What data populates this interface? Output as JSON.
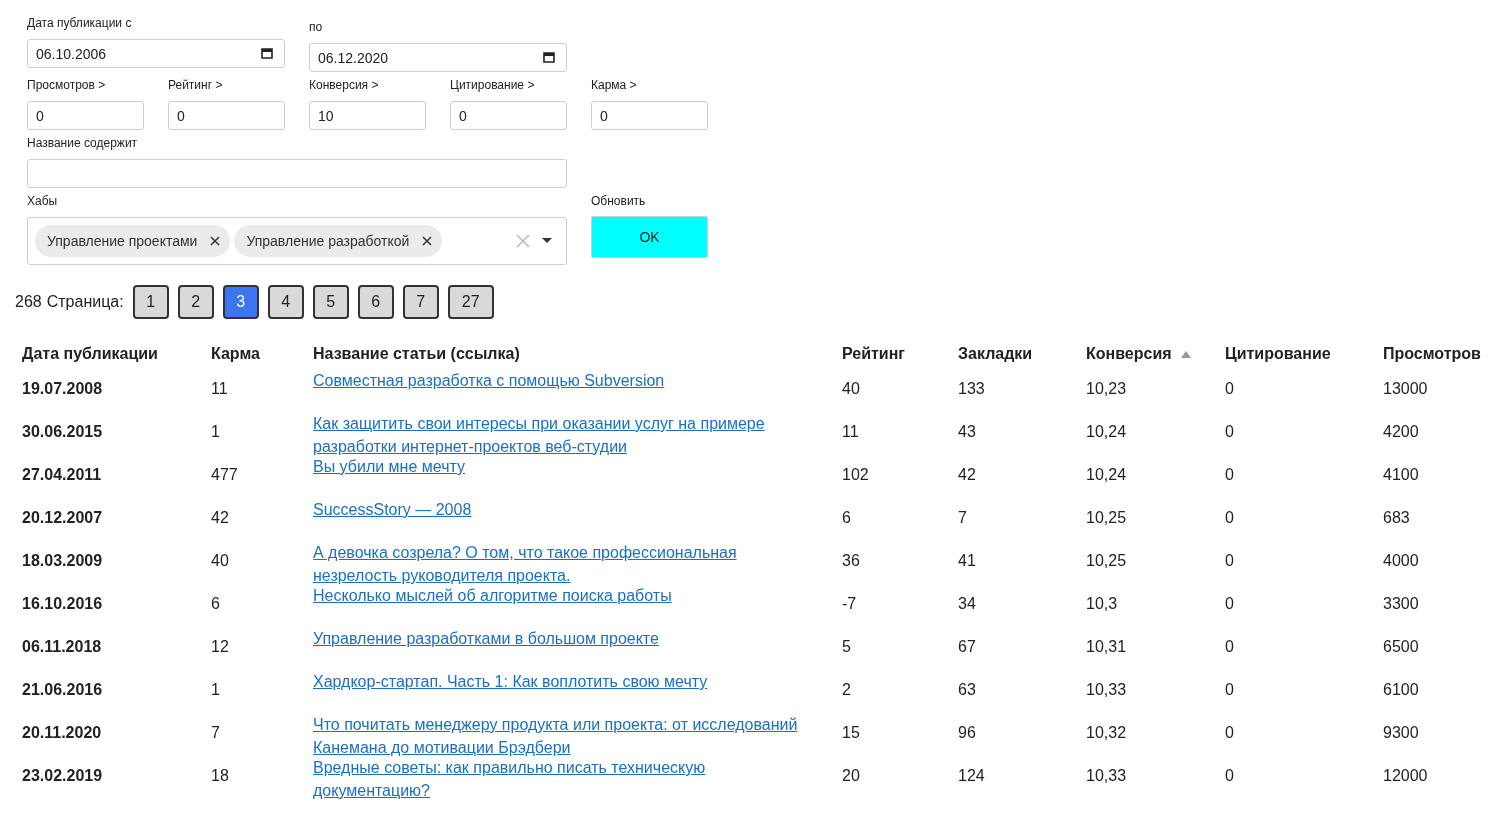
{
  "filters": {
    "date_from": {
      "label": "Дата публикации с",
      "value": "06.10.2006"
    },
    "date_to": {
      "label": "по",
      "value": "06.12.2020"
    },
    "thresholds": [
      {
        "label": "Просмотров >",
        "value": "0"
      },
      {
        "label": "Рейтинг >",
        "value": "0"
      },
      {
        "label": "Конверсия >",
        "value": "10"
      },
      {
        "label": "Цитирование >",
        "value": "0"
      },
      {
        "label": "Карма >",
        "value": "0"
      }
    ],
    "title_contains": {
      "label": "Название содержит"
    },
    "hubs": {
      "label": "Хабы",
      "chips": [
        "Управление проектами",
        "Управление разработкой"
      ]
    },
    "refresh": {
      "label": "Обновить",
      "button": "OK"
    }
  },
  "pagination": {
    "total": "268",
    "label": "Страница:",
    "pages": [
      {
        "label": "1",
        "selected": false
      },
      {
        "label": "2",
        "selected": false
      },
      {
        "label": "3",
        "selected": true
      },
      {
        "label": "4",
        "selected": false
      },
      {
        "label": "5",
        "selected": false
      },
      {
        "label": "6",
        "selected": false
      },
      {
        "label": "7",
        "selected": false
      },
      {
        "label": "27",
        "selected": false
      }
    ]
  },
  "table": {
    "columns": [
      {
        "label": "Дата публикации",
        "sorted": false
      },
      {
        "label": "Карма",
        "sorted": false
      },
      {
        "label": "Название статьи (ссылка)",
        "sorted": false
      },
      {
        "label": "Рейтинг",
        "sorted": false
      },
      {
        "label": "Закладки",
        "sorted": false
      },
      {
        "label": "Конверсия",
        "sorted": true
      },
      {
        "label": "Цитирование",
        "sorted": false
      },
      {
        "label": "Просмотров",
        "sorted": false
      }
    ],
    "rows": [
      [
        "19.07.2008",
        "11",
        "Совместная разработка с помощью Subversion",
        "40",
        "133",
        "10,23",
        "0",
        "13000"
      ],
      [
        "30.06.2015",
        "1",
        "Как защитить свои интересы при оказании услуг на примере разработки интернет-проектов веб-студии",
        "11",
        "43",
        "10,24",
        "0",
        "4200"
      ],
      [
        "27.04.2011",
        "477",
        "Вы убили мне мечту",
        "102",
        "42",
        "10,24",
        "0",
        "4100"
      ],
      [
        "20.12.2007",
        "42",
        "SuccessStory — 2008",
        "6",
        "7",
        "10,25",
        "0",
        "683"
      ],
      [
        "18.03.2009",
        "40",
        "А девочка созрела? О том, что такое профессиональная незрелость руководителя проекта.",
        "36",
        "41",
        "10,25",
        "0",
        "4000"
      ],
      [
        "16.10.2016",
        "6",
        "Несколько мыслей об алгоритме поиска работы",
        "-7",
        "34",
        "10,3",
        "0",
        "3300"
      ],
      [
        "06.11.2018",
        "12",
        "Управление разработками в большом проекте",
        "5",
        "67",
        "10,31",
        "0",
        "6500"
      ],
      [
        "21.06.2016",
        "1",
        "Хардкор-стартап. Часть 1: Как воплотить свою мечту",
        "2",
        "63",
        "10,33",
        "0",
        "6100"
      ],
      [
        "20.11.2020",
        "7",
        "Что почитать менеджеру продукта или проекта: от исследований Канемана до мотивации Брэдбери",
        "15",
        "96",
        "10,32",
        "0",
        "9300"
      ],
      [
        "23.02.2019",
        "18",
        "Вредные советы: как правильно писать техническую документацию?",
        "20",
        "124",
        "10,33",
        "0",
        "12000"
      ]
    ]
  }
}
